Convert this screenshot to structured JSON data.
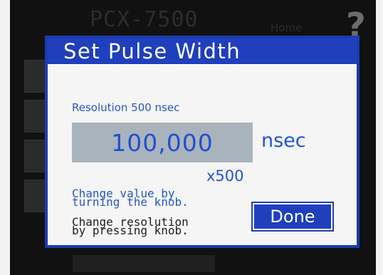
{
  "background": {
    "device_title": "PCX-7500",
    "home_label": "Home",
    "help_icon": "?"
  },
  "dialog": {
    "title": "Set Pulse Width",
    "resolution_text": "Resolution 500 nsec",
    "value": "100,000",
    "unit": "nsec",
    "multiplier": "x500",
    "hint_change_value": "Change value by\nturning the knob.",
    "hint_change_resolution": "Change resolution\nby pressing knob.",
    "done_label": "Done"
  },
  "colors": {
    "accent": "#1f3fbd",
    "text_blue": "#2454d0",
    "value_box": "#a9b3bb"
  }
}
